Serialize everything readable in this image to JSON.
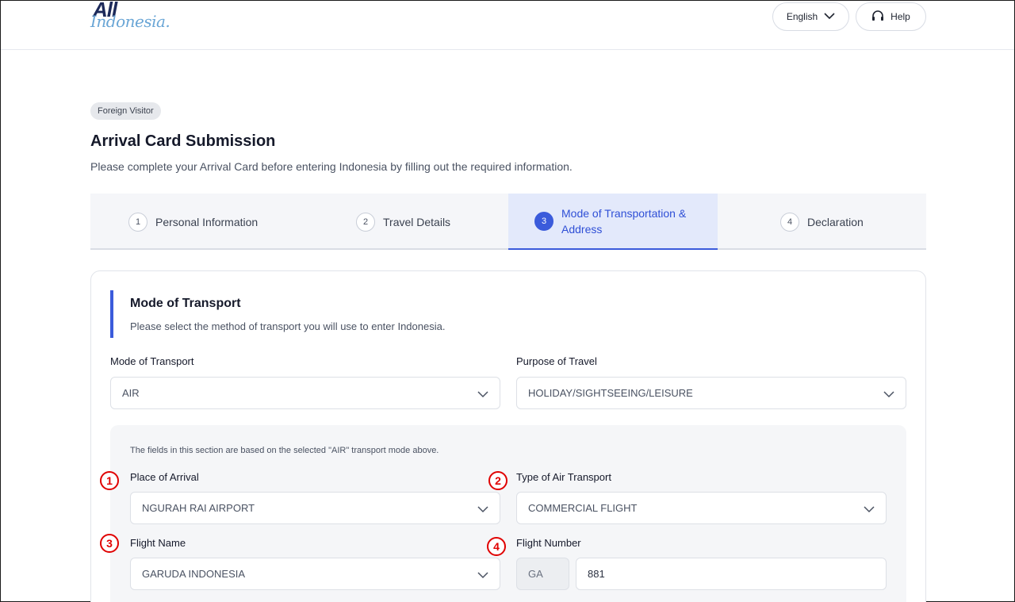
{
  "header": {
    "logo_main": "All",
    "logo_script": "Indonesia.",
    "language_label": "English",
    "help_label": "Help"
  },
  "page": {
    "badge": "Foreign Visitor",
    "title": "Arrival Card Submission",
    "subtitle": "Please complete your Arrival Card before entering Indonesia by filling out the required information."
  },
  "stepper": {
    "steps": [
      {
        "number": "1",
        "label": "Personal Information",
        "state": "inactive"
      },
      {
        "number": "2",
        "label": "Travel Details",
        "state": "inactive"
      },
      {
        "number": "3",
        "label": "Mode of Transportation & Address",
        "state": "active"
      },
      {
        "number": "4",
        "label": "Declaration",
        "state": "inactive"
      }
    ]
  },
  "section": {
    "title": "Mode of Transport",
    "subtitle": "Please select the method of transport you will use to enter Indonesia.",
    "mode_label": "Mode of Transport",
    "mode_value": "AIR",
    "purpose_label": "Purpose of Travel",
    "purpose_value": "HOLIDAY/SIGHTSEEING/LEISURE",
    "panel_note": "The fields in this section are based on the selected \"AIR\" transport mode above.",
    "place_label": "Place of Arrival",
    "place_value": "NGURAH RAI AIRPORT",
    "air_type_label": "Type of Air Transport",
    "air_type_value": "COMMERCIAL FLIGHT",
    "flight_name_label": "Flight Name",
    "flight_name_value": "GARUDA INDONESIA",
    "flight_number_label": "Flight Number",
    "flight_prefix": "GA",
    "flight_number_value": "881"
  },
  "markers": [
    "1",
    "2",
    "3",
    "4"
  ],
  "colors": {
    "accent": "#3b5bdb",
    "marker": "#e00000",
    "active_step_bg": "#e3e9fb"
  }
}
